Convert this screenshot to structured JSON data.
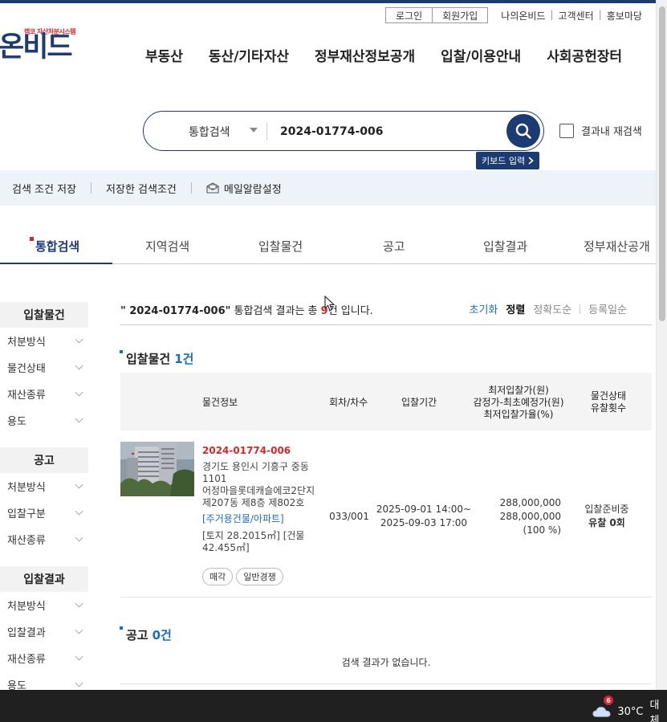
{
  "header": {
    "login_label": "로그인",
    "join_label": "회원가입",
    "links": [
      "나의온비드",
      "고객센터",
      "홍보마당"
    ],
    "logo_tagline": "캠코 자산처분시스템",
    "logo_text": "온비드",
    "gnb": [
      "부동산",
      "동산/기타자산",
      "정부재산정보공개",
      "입찰/이용안내",
      "사회공헌장터"
    ]
  },
  "search": {
    "scope": "통합검색",
    "query": "2024-01774-006",
    "keyboard_label": "키보드 입력",
    "research_label": "결과내 재검색"
  },
  "savebar": {
    "save_label": "검색 조건 저장",
    "saved_label": "저장한 검색조건",
    "mail_label": "메일알람설정"
  },
  "tabs": [
    "통합검색",
    "지역검색",
    "입찰물건",
    "공고",
    "입찰결과",
    "정부재산공개"
  ],
  "sidebar": {
    "groups": [
      {
        "title": "입찰물건",
        "items": [
          "처분방식",
          "물건상태",
          "재산종류",
          "용도"
        ]
      },
      {
        "title": "공고",
        "items": [
          "처분방식",
          "입찰구분",
          "재산종류"
        ]
      },
      {
        "title": "입찰결과",
        "items": [
          "처분방식",
          "입찰결과",
          "재산종류",
          "용도"
        ]
      }
    ]
  },
  "summary": {
    "quote_query": "\" 2024-01774-006\"",
    "mid": " 통합검색 결과는 총 ",
    "count": "9",
    "tail": "건 입니다."
  },
  "sort": {
    "reset": "초기화",
    "sort": "정렬",
    "accuracy": "정확도순",
    "regdate": "등록일순"
  },
  "section_bid": {
    "title": "입찰물건",
    "count": "1건"
  },
  "table_headers": {
    "info": "물건정보",
    "round": "회차/차수",
    "period": "입찰기간",
    "price_1": "최저입찰가(원)",
    "price_2": "감정가-최초예정가(원)",
    "price_3": "최저입찰가율(%)",
    "status_1": "물건상태",
    "status_2": "유찰횟수"
  },
  "item": {
    "number": "2024-01774-006",
    "addr_1": "경기도 용인시 기흥구 중동",
    "addr_2": "1101",
    "addr_3": "어정마을롯데캐슬에코2단지",
    "addr_4": "제207동 제8층 제802호",
    "use": "[주거용건물/아파트]",
    "area_1": "[토지 28.2015㎡] [건물",
    "area_2": "42.455㎡]",
    "chips": [
      "매각",
      "일반경쟁"
    ],
    "round": "033/001",
    "period_start": "2025-09-01 14:00~",
    "period_end": "2025-09-03 17:00",
    "min_price": "288,000,000",
    "appraisal": "288,000,000",
    "rate": "(100 %)",
    "status": "입찰준비중",
    "fail_count": "유찰 0회"
  },
  "section_notice": {
    "title": "공고",
    "count": "0건"
  },
  "empty_text": "검색 결과가 없습니다.",
  "taskbar": {
    "badge": "6",
    "temp": "30°C",
    "desc": "대체"
  },
  "colors": {
    "brand": "#1c3b73",
    "accent_red": "#d9262c",
    "link_blue": "#1c6fb8"
  }
}
